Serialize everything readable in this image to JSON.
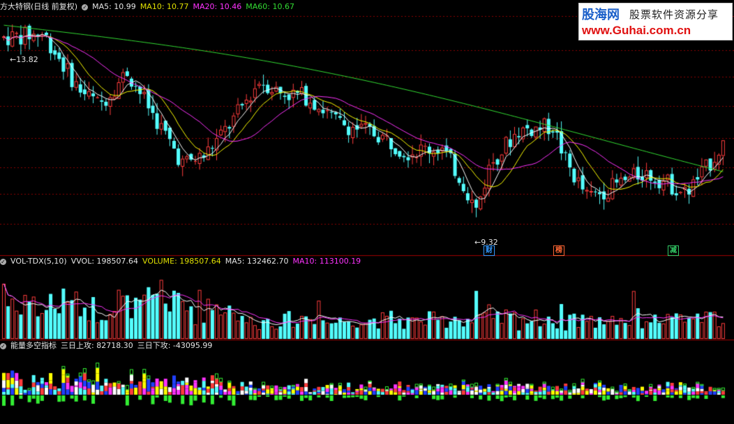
{
  "header_main": {
    "title": "方大特钢(日线 前复权)",
    "ma5": "MA5: 10.99",
    "ma10": "MA10: 10.77",
    "ma20": "MA20: 10.46",
    "ma60": "MA60: 10.67"
  },
  "header_vol": {
    "name": "VOL-TDX(5,10)",
    "vvol": "VVOL: 198507.64",
    "volume": "VOLUME: 198507.64",
    "ma5": "MA5: 132462.70",
    "ma10": "MA10: 113100.19"
  },
  "header_ind": {
    "name": "能量多空指标",
    "up": "三日上攻: 82718.30",
    "down": "三日下攻: -43095.99"
  },
  "annotations": {
    "high": "13.82",
    "low": "9.32"
  },
  "events": [
    {
      "label": "财",
      "color": "#3399ff"
    },
    {
      "label": "榜",
      "color": "#ff6633"
    },
    {
      "label": "减",
      "color": "#33cc66"
    }
  ],
  "watermark": {
    "brand": "股海网",
    "tagline": "股票软件资源分享",
    "url": "www.Guhai.com.cn"
  },
  "colors": {
    "up": "#ff3c3c",
    "down": "#54ffff",
    "ma5": "#ffffff",
    "ma10": "#ffff00",
    "ma20": "#ff33ff",
    "ma60": "#33dd33",
    "grid": "#8b0000"
  }
}
